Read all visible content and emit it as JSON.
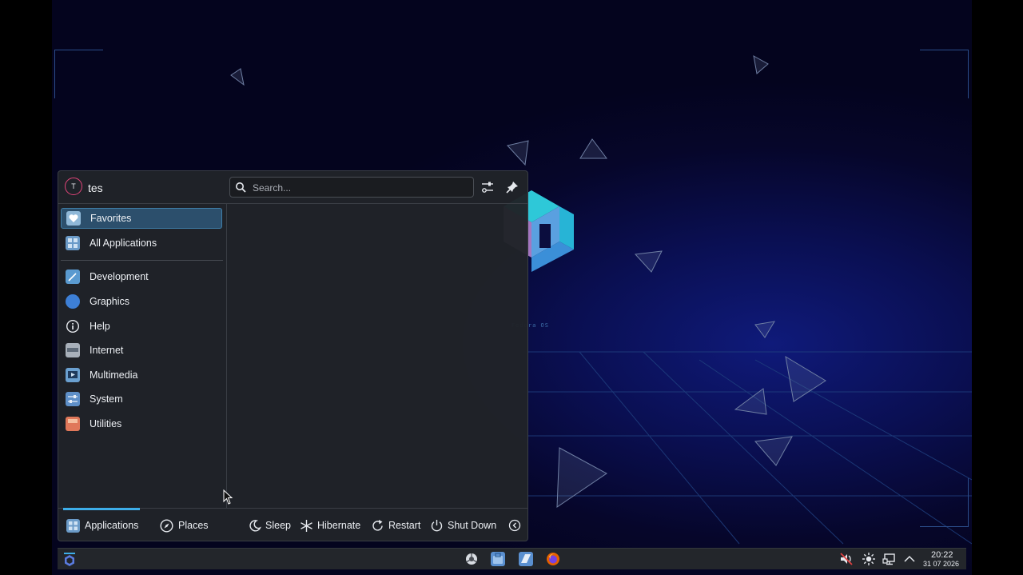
{
  "launcher": {
    "user": {
      "initial": "T",
      "name": "tes"
    },
    "search": {
      "placeholder": "Search..."
    },
    "sidebar": {
      "items": [
        {
          "label": "Favorites",
          "icon": "favorites-icon",
          "color": "#8fb8d8"
        },
        {
          "label": "All Applications",
          "icon": "grid-icon",
          "color": "#6b9bc8"
        },
        {
          "label": "Development",
          "icon": "development-icon",
          "color": "#5a9ad0"
        },
        {
          "label": "Graphics",
          "icon": "graphics-icon",
          "color": "#3d7fd6"
        },
        {
          "label": "Help",
          "icon": "help-icon",
          "color": "#e6e9ee"
        },
        {
          "label": "Internet",
          "icon": "internet-icon",
          "color": "#a8b0ba"
        },
        {
          "label": "Multimedia",
          "icon": "multimedia-icon",
          "color": "#6aa0d0"
        },
        {
          "label": "System",
          "icon": "system-icon",
          "color": "#5e8fc8"
        },
        {
          "label": "Utilities",
          "icon": "utilities-icon",
          "color": "#e0785a"
        }
      ],
      "active": "Favorites"
    },
    "footer": {
      "tabs": [
        {
          "label": "Applications",
          "icon": "applications-icon"
        },
        {
          "label": "Places",
          "icon": "places-icon"
        }
      ],
      "active_tab": "Applications",
      "power": [
        {
          "label": "Sleep",
          "icon": "sleep-icon"
        },
        {
          "label": "Hibernate",
          "icon": "hibernate-icon"
        },
        {
          "label": "Restart",
          "icon": "restart-icon"
        },
        {
          "label": "Shut Down",
          "icon": "shutdown-icon"
        }
      ]
    }
  },
  "desktop": {
    "distro_label": "Fedora OS"
  },
  "taskbar": {
    "clock": {
      "time": "20:22",
      "date": "31 07 2026"
    },
    "pinned": [
      "settings-icon",
      "store-icon",
      "file-manager-icon",
      "firefox-icon"
    ],
    "tray": [
      "muted-speaker-icon",
      "brightness-icon",
      "network-icon",
      "expand-tray-icon"
    ]
  },
  "colors": {
    "accent": "#3daee9",
    "avatar_ring": "#e2457a",
    "panel": "#202328"
  }
}
